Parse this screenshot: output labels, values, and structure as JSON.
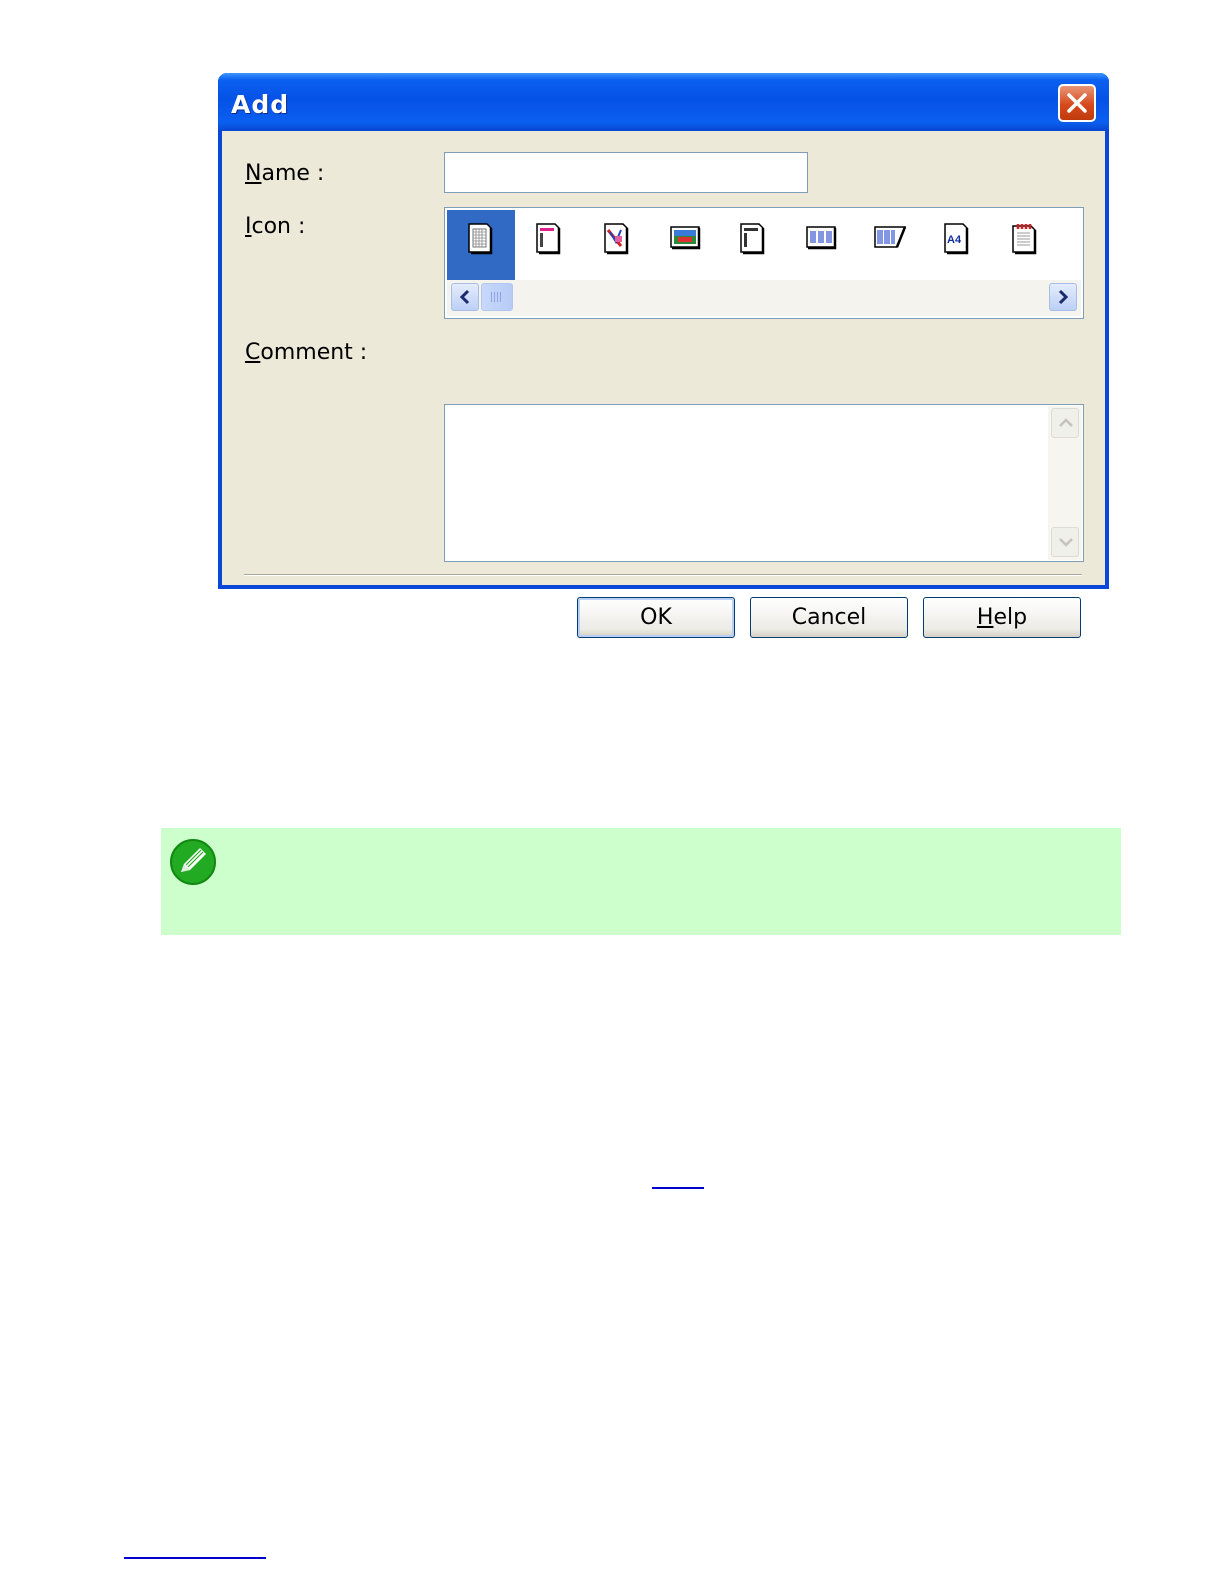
{
  "dialog": {
    "title": "Add",
    "name_label_u": "N",
    "name_label_rest": "ame :",
    "name_value": "",
    "icon_label_u": "I",
    "icon_label_rest": "con :",
    "comment_label_u": "C",
    "comment_label_rest": "omment :",
    "comment_value": "",
    "icons": [
      "grid-page-icon",
      "pink-page-icon",
      "photo-text-page-icon",
      "landscape-photo-icon",
      "text-page-icon",
      "columns-page-icon",
      "folded-columns-icon",
      "a4-page-icon",
      "red-header-page-icon"
    ],
    "a4_icon_text": "A4",
    "selected_icon_index": 0,
    "buttons": {
      "ok": "OK",
      "cancel": "Cancel",
      "help_u": "H",
      "help_rest": "elp"
    }
  },
  "colors": {
    "titlebar": "#0a5ff0",
    "selection": "#316ac5",
    "note_background": "#ccffcc"
  }
}
